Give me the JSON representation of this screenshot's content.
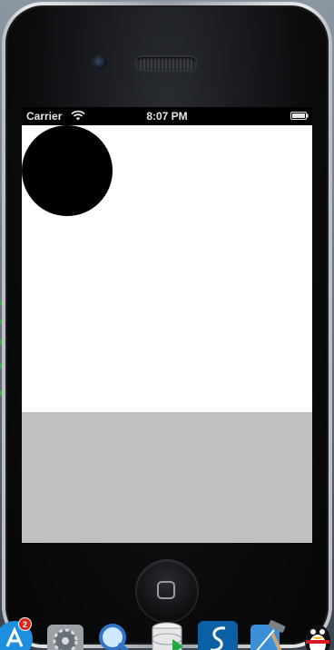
{
  "status_bar": {
    "carrier": "Carrier",
    "time": "8:07 PM",
    "wifi_icon": "wifi-icon",
    "battery_icon": "battery-icon"
  },
  "app": {
    "background_color": "#ffffff",
    "circle_color": "#000000",
    "bottom_panel_color": "#c0c0c0"
  },
  "dock": {
    "items": [
      {
        "name": "app-store-icon",
        "badge": "2"
      },
      {
        "name": "system-preferences-icon"
      },
      {
        "name": "preview-icon"
      },
      {
        "name": "database-icon"
      },
      {
        "name": "safari-like-icon"
      },
      {
        "name": "xcode-icon"
      },
      {
        "name": "qq-icon"
      }
    ]
  }
}
